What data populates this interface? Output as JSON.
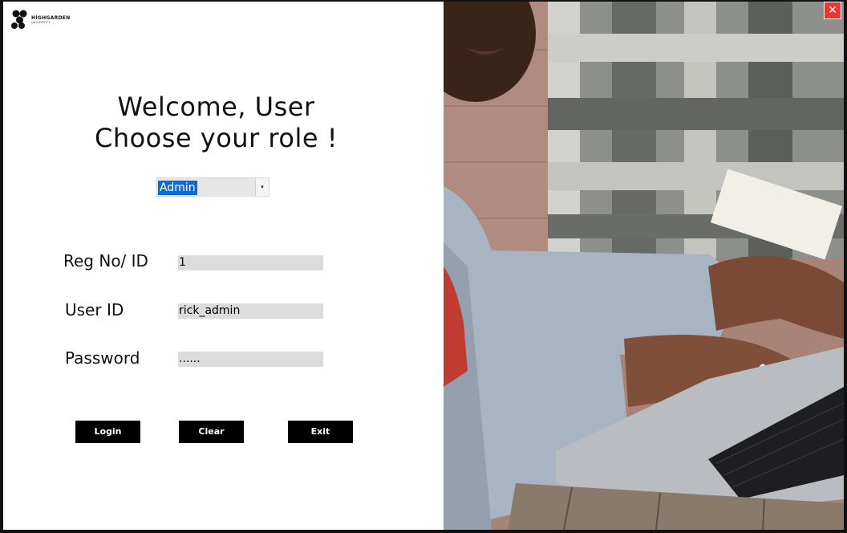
{
  "logo": {
    "name": "HIGHGARDEN",
    "subtitle": "UNIVERSITY"
  },
  "welcome": {
    "line1": "Welcome, User",
    "line2": "Choose your role !"
  },
  "role": {
    "selected": "Admin",
    "arrow": "▾"
  },
  "form": {
    "reg_label": "Reg No/ ID",
    "reg_value": "1",
    "user_label": "User ID",
    "user_value": "rick_admin",
    "password_label": "Password",
    "password_value": "......"
  },
  "buttons": {
    "login": "Login",
    "clear": "Clear",
    "exit": "Exit"
  },
  "window": {
    "close_icon": "✕"
  },
  "colors": {
    "accent": "#0a6bd6",
    "button_bg": "#000000",
    "close_bg": "#e53935",
    "field_bg": "#dcdcdc"
  },
  "icons": {
    "logo": "hexagon-cluster-logo-icon",
    "close": "close-icon",
    "dropdown": "chevron-down-icon"
  }
}
